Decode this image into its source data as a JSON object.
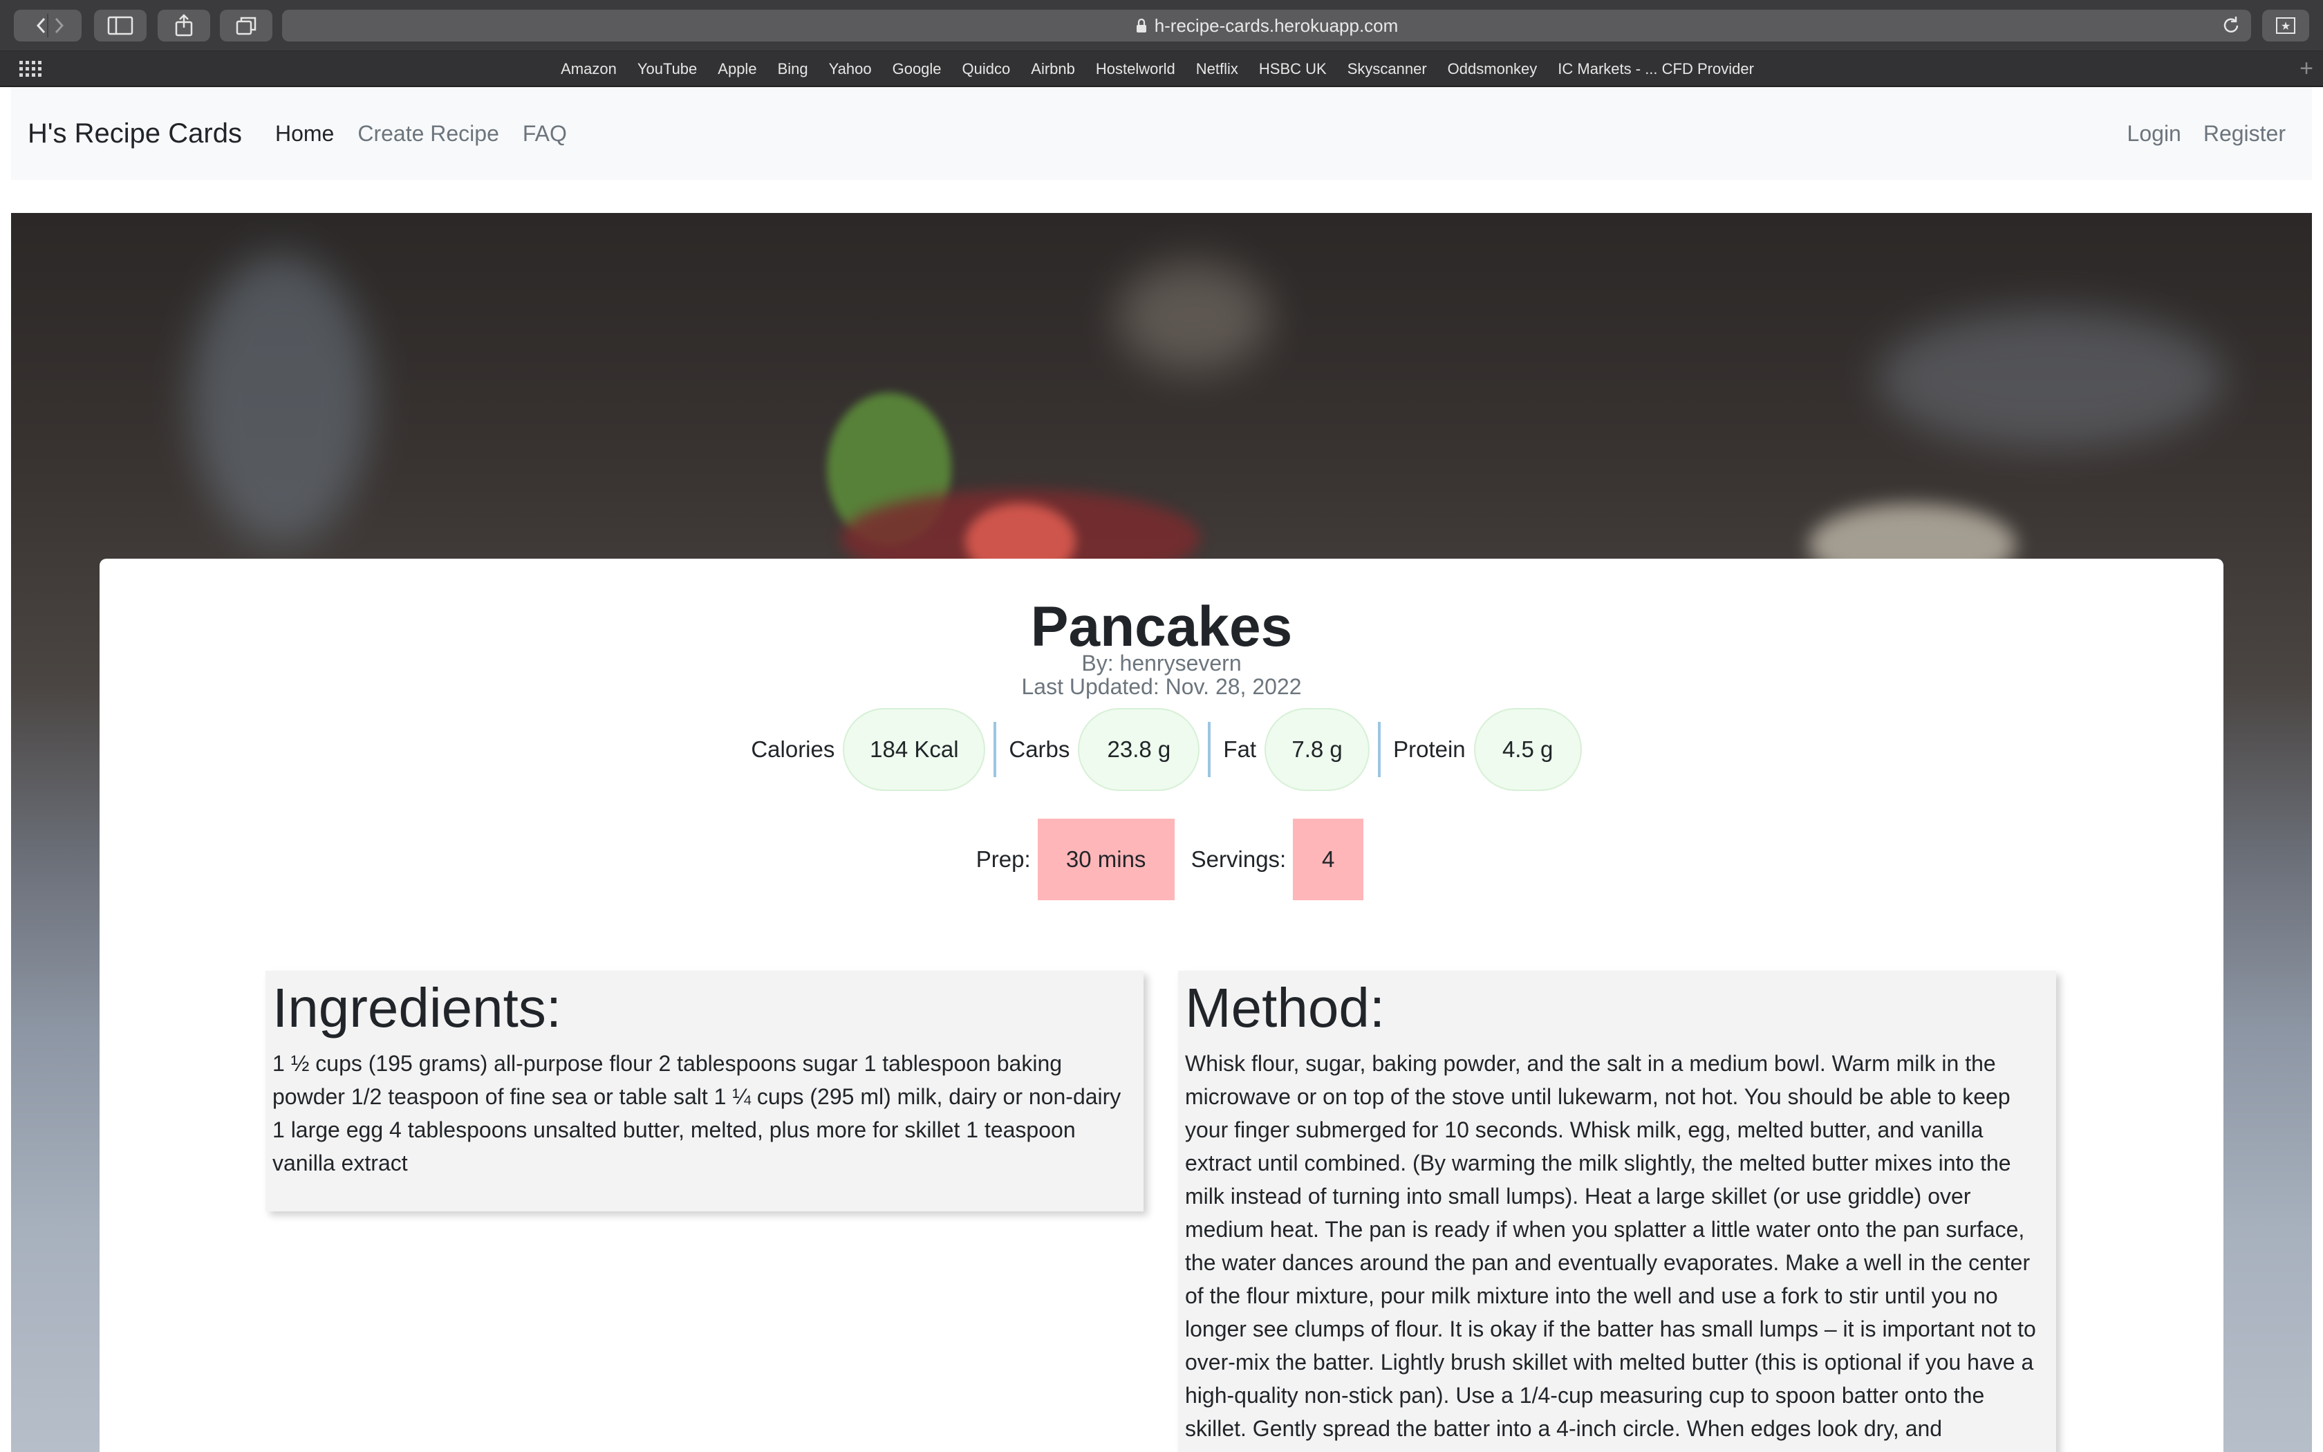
{
  "browser": {
    "url": "h-recipe-cards.herokuapp.com",
    "bookmarks": [
      "Amazon",
      "YouTube",
      "Apple",
      "Bing",
      "Yahoo",
      "Google",
      "Quidco",
      "Airbnb",
      "Hostelworld",
      "Netflix",
      "HSBC UK",
      "Skyscanner",
      "Oddsmonkey",
      "IC Markets - ... CFD Provider"
    ]
  },
  "navbar": {
    "brand": "H's Recipe Cards",
    "links": [
      "Home",
      "Create Recipe",
      "FAQ"
    ],
    "right_links": [
      "Login",
      "Register"
    ]
  },
  "recipe": {
    "title": "Pancakes",
    "author": "By: henrysevern",
    "updated": "Last Updated: Nov. 28, 2022",
    "nutrition": [
      {
        "label": "Calories",
        "value": "184 Kcal"
      },
      {
        "label": "Carbs",
        "value": "23.8 g"
      },
      {
        "label": "Fat",
        "value": "7.8 g"
      },
      {
        "label": "Protein",
        "value": "4.5 g"
      }
    ],
    "prep_label": "Prep:",
    "prep_value": "30 mins",
    "servings_label": "Servings:",
    "servings_value": "4",
    "ingredients_heading": "Ingredients:",
    "ingredients_text": "1 ½ cups (195 grams) all-purpose flour 2 tablespoons sugar 1 tablespoon baking powder 1/2 teaspoon of fine sea or table salt 1 ¼ cups (295 ml) milk, dairy or non-dairy 1 large egg 4 tablespoons unsalted butter, melted, plus more for skillet 1 teaspoon vanilla extract",
    "method_heading": "Method:",
    "method_text": "Whisk flour, sugar, baking powder, and the salt in a medium bowl. Warm milk in the microwave or on top of the stove until lukewarm, not hot. You should be able to keep your finger submerged for 10 seconds. Whisk milk, egg, melted butter, and vanilla extract until combined. (By warming the milk slightly, the melted butter mixes into the milk instead of turning into small lumps). Heat a large skillet (or use griddle) over medium heat. The pan is ready if when you splatter a little water onto the pan surface, the water dances around the pan and eventually evaporates. Make a well in the center of the flour mixture, pour milk mixture into the well and use a fork to stir until you no longer see clumps of flour. It is okay if the batter has small lumps – it is important not to over-mix the batter. Lightly brush skillet with melted butter (this is optional if you have a high-quality non-stick pan). Use a 1/4-cup measuring cup to spoon batter onto the skillet. Gently spread the batter into a 4-inch circle. When edges look dry, and"
  },
  "colors": {
    "nutrition_pill": "#eefbee",
    "timing_box": "#ffb6b9",
    "separator": "#9bc6e2",
    "navbar_bg": "#f8f9fa"
  }
}
